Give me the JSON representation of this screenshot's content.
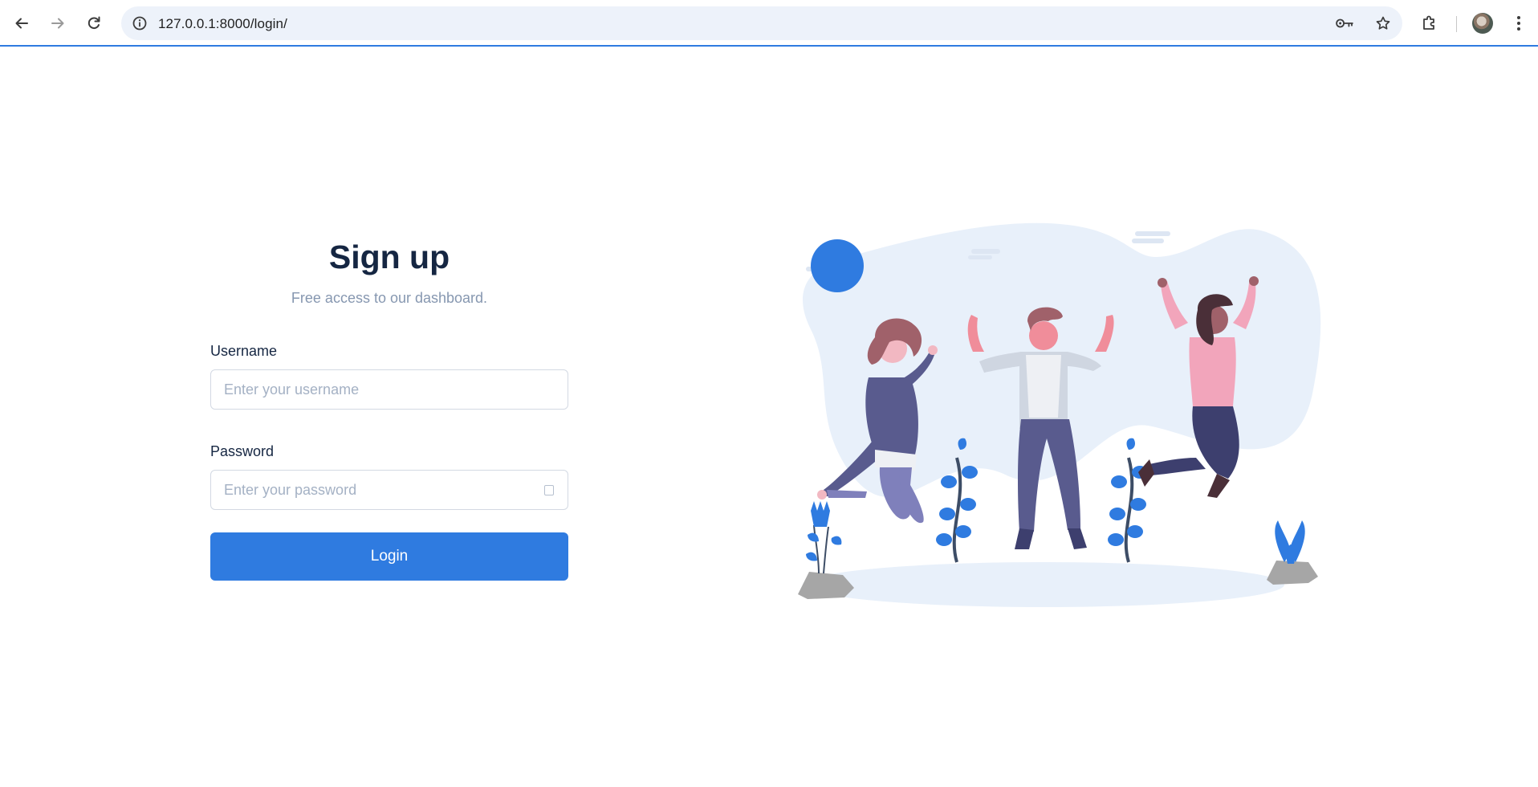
{
  "browser": {
    "url": "127.0.0.1:8000/login/",
    "icons": [
      "back-arrow-icon",
      "forward-arrow-icon",
      "reload-icon",
      "site-info-icon",
      "password-key-icon",
      "bookmark-star-icon",
      "extensions-puzzle-icon",
      "profile-avatar",
      "more-vert-icon"
    ]
  },
  "form": {
    "title": "Sign up",
    "subtitle": "Free access to our dashboard.",
    "username_label": "Username",
    "username_placeholder": "Enter your username",
    "password_label": "Password",
    "password_placeholder": "Enter your password",
    "login_label": "Login"
  },
  "colors": {
    "accent": "#2f7be0",
    "heading": "#152642",
    "muted": "#8697b0",
    "illustration_bg": "#e8f0fa"
  }
}
